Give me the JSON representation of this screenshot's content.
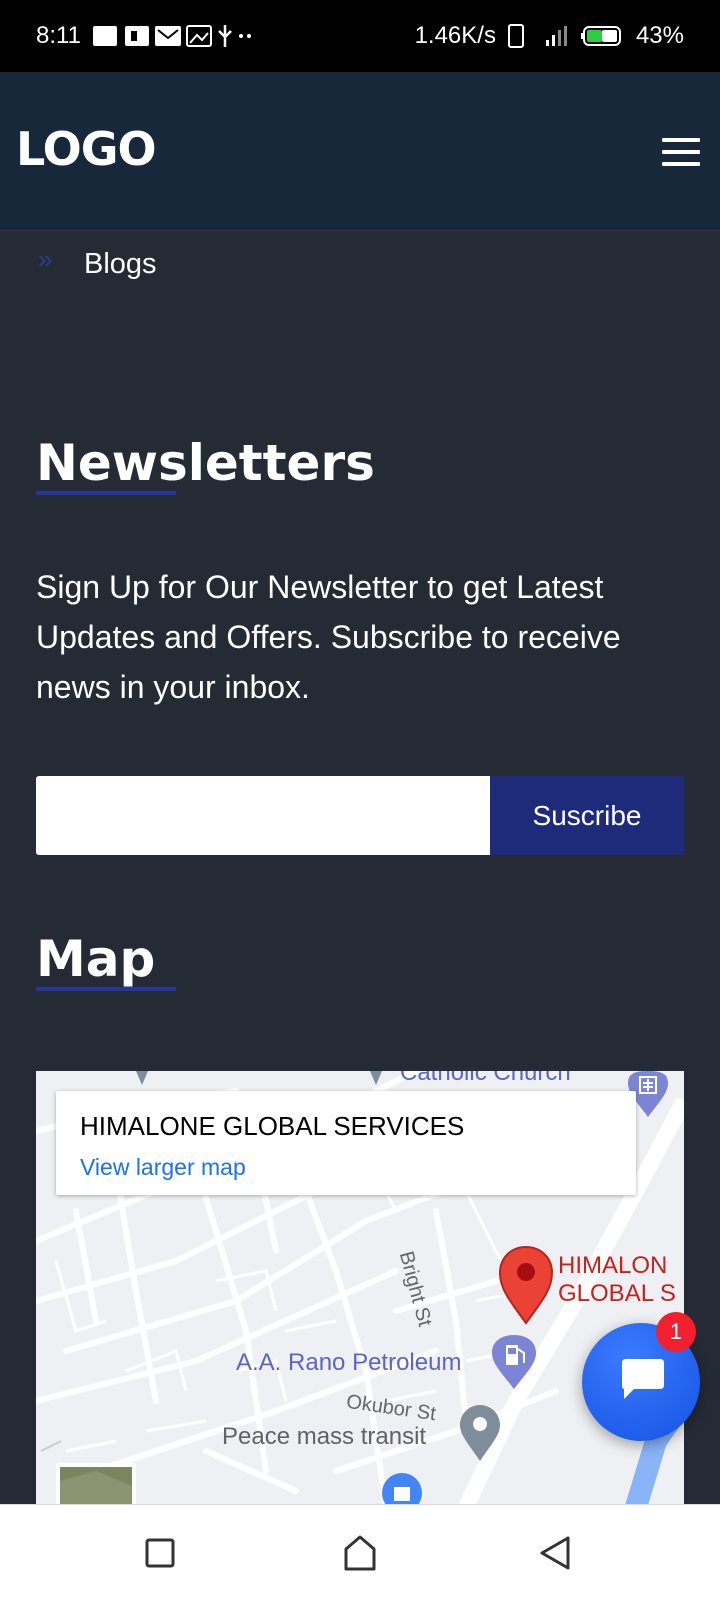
{
  "status_bar": {
    "time": "8:11",
    "network_speed": "1.46K/s",
    "battery": "43%"
  },
  "header": {
    "logo": "LOGO",
    "menu_icon": "hamburger-menu-icon"
  },
  "breadcrumb": {
    "label": "Blogs",
    "icon": "double-chevron-right-icon"
  },
  "newsletter": {
    "title": "Newsletters",
    "description": "Sign Up for Our Newsletter to get Latest Updates and Offers. Subscribe to receive news in your inbox.",
    "email_value": "",
    "button_label": "Suscribe"
  },
  "map": {
    "title": "Map",
    "card_place": "HIMALONE GLOBAL SERVICES",
    "card_link": "View larger map",
    "labels": {
      "church": "Catholic Church",
      "street1": "Bright St",
      "street2": "Okubor St",
      "petrol": "A.A. Rano Petroleum",
      "transit": "Peace mass transit",
      "pin_line1": "HIMALON",
      "pin_line2": "GLOBAL S"
    }
  },
  "chat": {
    "badge_count": "1",
    "icon": "chat-bubble-icon"
  },
  "nav": {
    "recent_icon": "square-icon",
    "home_icon": "home-icon",
    "back_icon": "back-triangle-icon"
  },
  "colors": {
    "page_bg": "#252b35",
    "header_bg": "#16283a",
    "accent": "#1d2b7a",
    "chat_blue": "#1f5ef0",
    "badge_red": "#f2202e"
  }
}
